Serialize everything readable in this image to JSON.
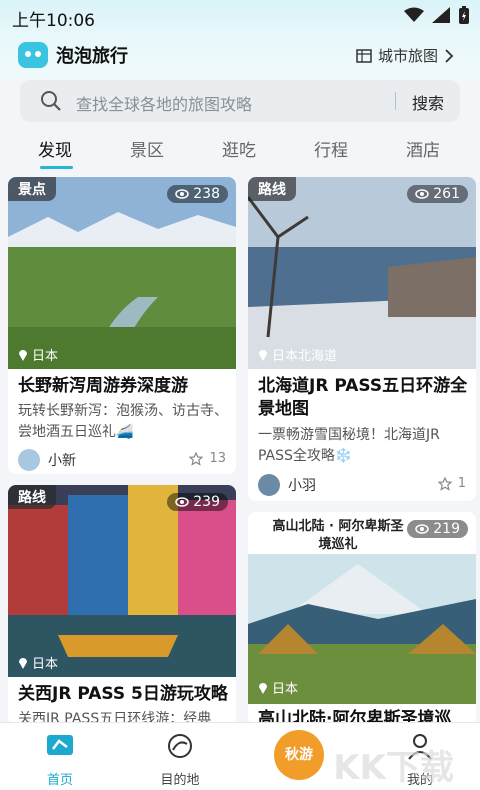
{
  "status": {
    "time": "上午10:06"
  },
  "app": {
    "name": "泡泡旅行",
    "city_map": "城市旅图"
  },
  "search": {
    "placeholder": "查找全球各地的旅图攻略",
    "button": "搜索"
  },
  "tabs": [
    {
      "label": "发现"
    },
    {
      "label": "景区"
    },
    {
      "label": "逛吃"
    },
    {
      "label": "行程"
    },
    {
      "label": "酒店"
    }
  ],
  "cards": [
    {
      "badge": "景点",
      "views": "238",
      "location": "日本",
      "title": "长野新泻周游券深度游",
      "desc": "玩转长野新泻：泡猴汤、访古寺、尝地酒五日巡礼🚄",
      "author": "小新",
      "likes": "13"
    },
    {
      "badge": "路线",
      "views": "261",
      "location": "日本北海道",
      "title": "北海道JR PASS五日环游全景地图",
      "desc": "一票畅游雪国秘境！北海道JR PASS全攻略❄️",
      "author": "小羽",
      "likes": "1"
    },
    {
      "badge": "路线",
      "views": "239",
      "location": "日本",
      "title": "关西JR PASS 5日游玩攻略",
      "desc": "关西JR PASS五日环线游：经典"
    },
    {
      "badge": "",
      "views": "219",
      "location": "日本",
      "photo_text": "高山北陆 · 阿尔卑斯圣境巡礼",
      "title": "高山北陆·阿尔卑斯圣境巡"
    }
  ],
  "nav": [
    {
      "label": "首页"
    },
    {
      "label": "目的地"
    },
    {
      "label": "秋游"
    },
    {
      "label": "我的"
    }
  ],
  "watermark": "KK下载",
  "colors": {
    "accent": "#23b6d6",
    "nav_active": "#1ba9cf",
    "autumn": "#f29c2a"
  }
}
